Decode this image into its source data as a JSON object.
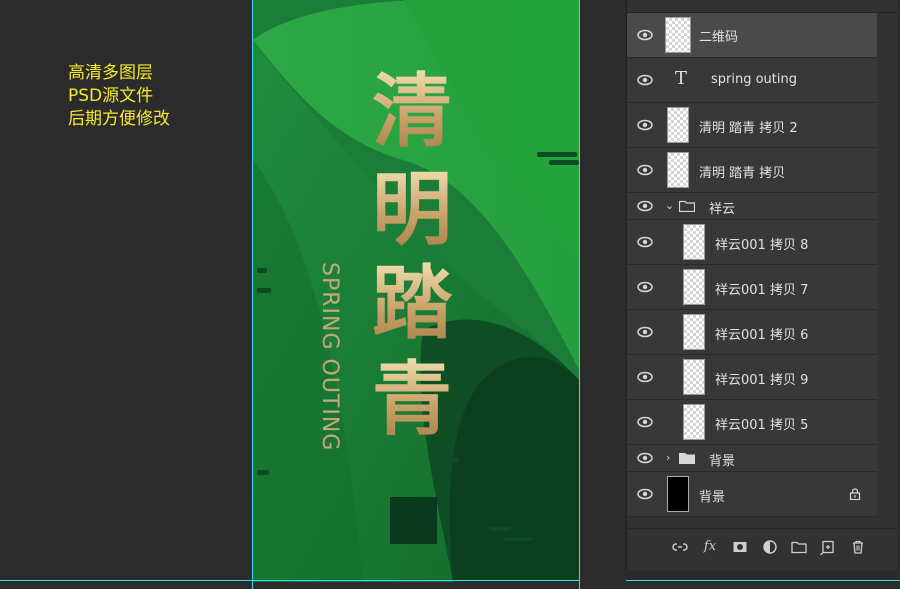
{
  "note": {
    "lines": [
      "高清多图层",
      "PSD源文件",
      "后期方便修改"
    ]
  },
  "poster": {
    "title_chars": [
      "清",
      "明",
      "踏",
      "青"
    ],
    "subtitle": "SPRING OUTING"
  },
  "layers": [
    {
      "name": "二维码",
      "kind": "image",
      "selected": true
    },
    {
      "name": "spring outing",
      "kind": "text"
    },
    {
      "name": "清明 踏青 拷贝 2",
      "kind": "image"
    },
    {
      "name": "清明 踏青 拷贝",
      "kind": "image"
    },
    {
      "name": "祥云",
      "kind": "group-open"
    },
    {
      "name": "祥云001 拷贝 8",
      "kind": "image-child"
    },
    {
      "name": "祥云001 拷贝 7",
      "kind": "image-child"
    },
    {
      "name": "祥云001 拷贝 6",
      "kind": "image-child"
    },
    {
      "name": "祥云001 拷贝 9",
      "kind": "image-child"
    },
    {
      "name": "祥云001 拷贝 5",
      "kind": "image-child"
    },
    {
      "name": "背景",
      "kind": "group-closed"
    },
    {
      "name": "背景",
      "kind": "background-locked"
    }
  ],
  "footer_icons": [
    "link-layers-icon",
    "fx-icon",
    "add-mask-icon",
    "adjustment-layer-icon",
    "new-group-icon",
    "new-layer-icon",
    "delete-layer-icon"
  ],
  "colors": {
    "guide": "#3fd9e6",
    "note": "#f5e92a",
    "gold": "#d9bd82"
  }
}
